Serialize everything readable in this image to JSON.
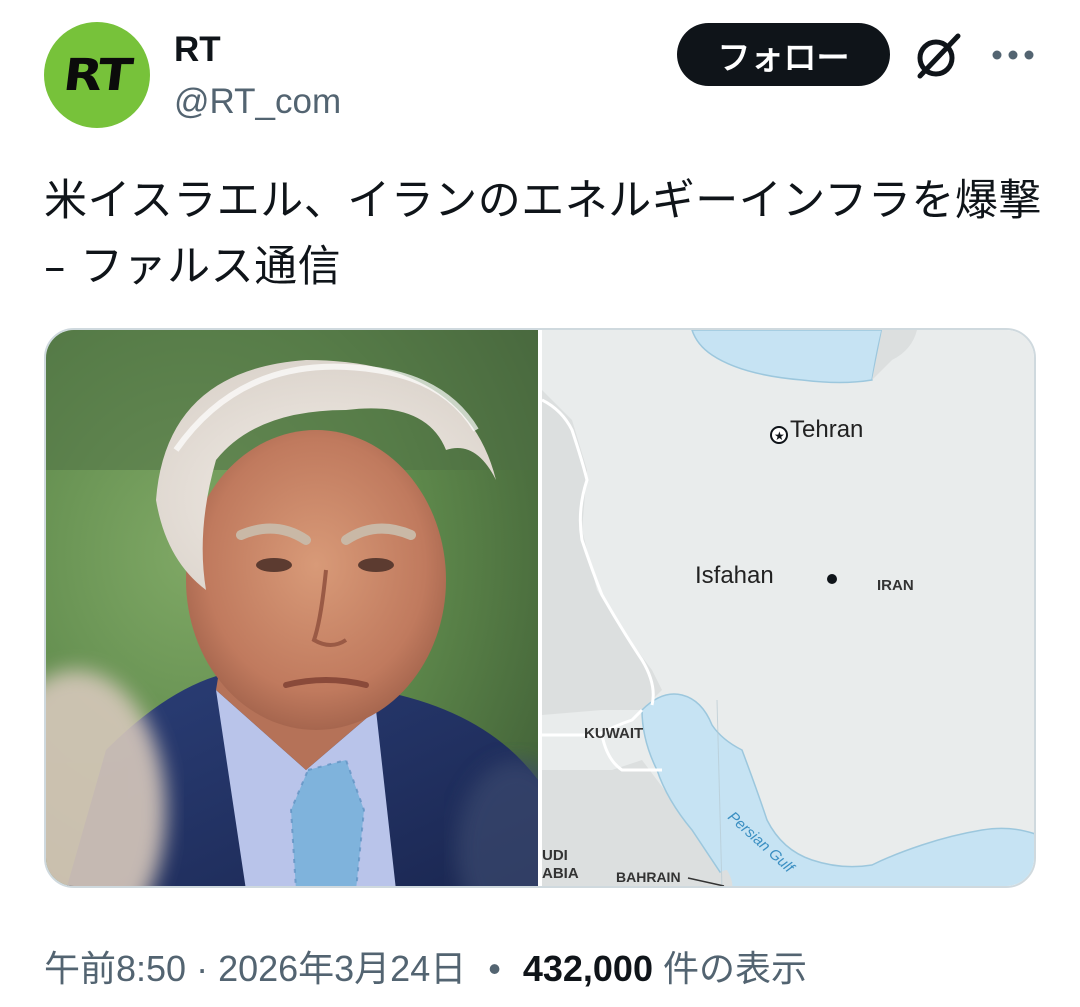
{
  "account": {
    "display_name": "RT",
    "handle": "@RT_com",
    "avatar_text": "RT",
    "avatar_color": "#77c23a"
  },
  "actions": {
    "follow_label": "フォロー",
    "grok_icon": "grok-icon",
    "more_icon": "more-icon"
  },
  "tweet": {
    "text": "米イスラエル、イランのエネルギーインフラを爆撃 – ファルス通信"
  },
  "map": {
    "labels": {
      "tehran": "Tehran",
      "isfahan": "Isfahan",
      "iran": "IRAN",
      "kuwait": "KUWAIT",
      "saudi_line1": "UDI",
      "saudi_line2": "ABIA",
      "bahrain": "BAHRAIN",
      "persian_gulf": "Persian Gulf"
    }
  },
  "meta": {
    "time": "午前8:50",
    "dot1": "·",
    "date": "2026年3月24日",
    "dot2": "•",
    "views_count": "432,000",
    "views_label": "件の表示"
  },
  "colors": {
    "follow_bg": "#0f1419",
    "secondary_text": "#536471",
    "map_land": "#e9ecec",
    "map_water": "#c6e3f3"
  }
}
